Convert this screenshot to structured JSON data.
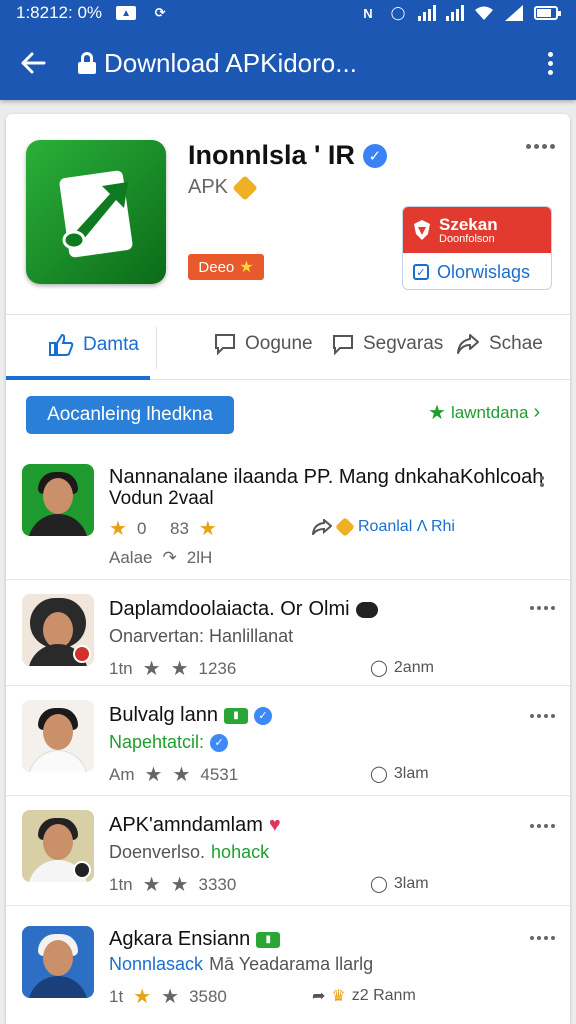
{
  "status_bar": {
    "time": "1:8212: 0%"
  },
  "app_bar": {
    "title": "Download APKidoro..."
  },
  "app": {
    "title": "Inonnlsla ' IR",
    "subtitle": "APK",
    "tag": "Deeo",
    "download_box": {
      "top_title": "Szekan",
      "top_subtitle": "Doonfolson",
      "bottom_label": "Olorwislags"
    }
  },
  "tabs": [
    {
      "label": "Damta"
    },
    {
      "label": "Oogune"
    },
    {
      "label": "Segvaras"
    },
    {
      "label": "Schae"
    }
  ],
  "filter": {
    "chip_label": "Aocanleing lhedkna",
    "trend_label": "lawntdana"
  },
  "rows": [
    {
      "title": "Nannanalane ilaanda PP. Mang dnkahaKohlcoah",
      "subtitle": "Vodun 2vaal",
      "rating": "0     83",
      "right": "Roanlal Λ Rhi",
      "extra": "Aalae",
      "count": "2lH"
    },
    {
      "title": "Daplamdoolaiacta. Or",
      "title_tail": "Olmi",
      "subtitle": "Onarvertan: Hanlillanat",
      "time": "1tn",
      "rating": "1236",
      "right": "2anm"
    },
    {
      "title": "Bulvalg lann",
      "subtitle": "Napehtatcil:",
      "time": "Am",
      "rating": "4531",
      "right": "3lam"
    },
    {
      "title": "APK'amndamlam",
      "subtitle": "Doenverlso.",
      "subtitle_tail": "hohack",
      "time": "1tn",
      "rating": "3330",
      "right": "3lam"
    },
    {
      "title": "Agkara Ensiann",
      "subtitle": "Nonnlasack",
      "subtitle_tail": "Mā Yeadarama llarlg",
      "time": "1t",
      "rating": "3580",
      "right": "z2 Ranm"
    }
  ],
  "colors": {
    "app_bar": "#1b57b3",
    "accent_blue": "#1b6ed1",
    "accent_green": "#1e9e2e",
    "download_red": "#e23a2e",
    "tag_orange": "#e8592c",
    "star_gold": "#e6a317"
  }
}
